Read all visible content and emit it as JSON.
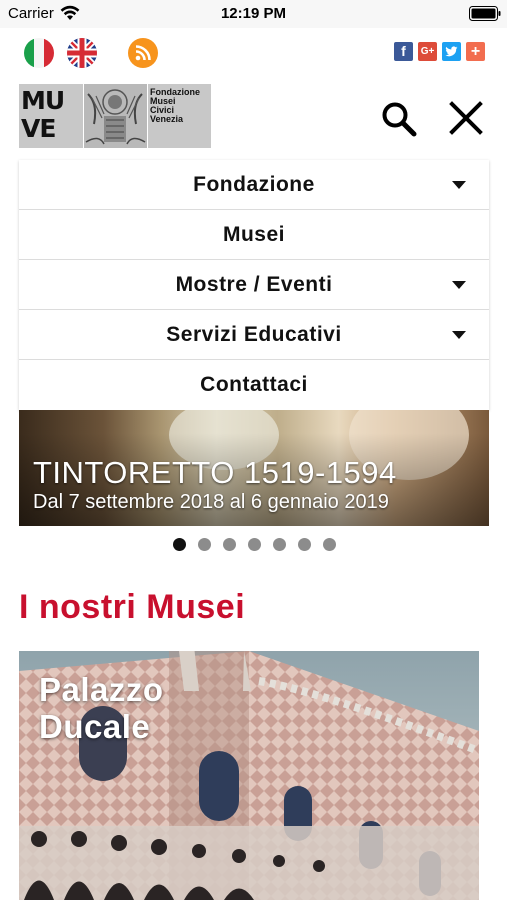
{
  "status_bar": {
    "carrier": "Carrier",
    "time": "12:19 PM"
  },
  "header": {
    "languages": [
      {
        "name": "italian-flag-icon"
      },
      {
        "name": "uk-flag-icon"
      }
    ],
    "rss_icon": "rss-icon",
    "social": [
      {
        "name": "facebook-icon",
        "glyph": "f",
        "color": "#3b5998"
      },
      {
        "name": "google-plus-icon",
        "glyph": "G+",
        "color": "#dd4b39"
      },
      {
        "name": "twitter-icon",
        "glyph": "",
        "color": "#1da1f2"
      },
      {
        "name": "share-plus-icon",
        "glyph": "+",
        "color": "#f26d4f"
      }
    ],
    "logo": {
      "muve_lines": [
        "MU",
        "VE"
      ],
      "text_lines": [
        "Fondazione",
        "Musei",
        "Civici",
        "Venezia"
      ]
    }
  },
  "menu": {
    "items": [
      {
        "label": "Fondazione",
        "has_submenu": true
      },
      {
        "label": "Musei",
        "has_submenu": false
      },
      {
        "label": "Mostre / Eventi",
        "has_submenu": true
      },
      {
        "label": "Servizi Educativi",
        "has_submenu": true
      },
      {
        "label": "Contattaci",
        "has_submenu": false
      }
    ]
  },
  "banner": {
    "title": "TINTORETTO 1519-1594",
    "subtitle": "Dal 7 settembre 2018 al 6 gennaio 2019"
  },
  "carousel": {
    "total": 7,
    "active_index": 0
  },
  "museums": {
    "heading": "I nostri Musei",
    "cards": [
      {
        "title_lines": [
          "Palazzo",
          "Ducale"
        ]
      }
    ]
  },
  "colors": {
    "accent_red": "#c8102e"
  }
}
